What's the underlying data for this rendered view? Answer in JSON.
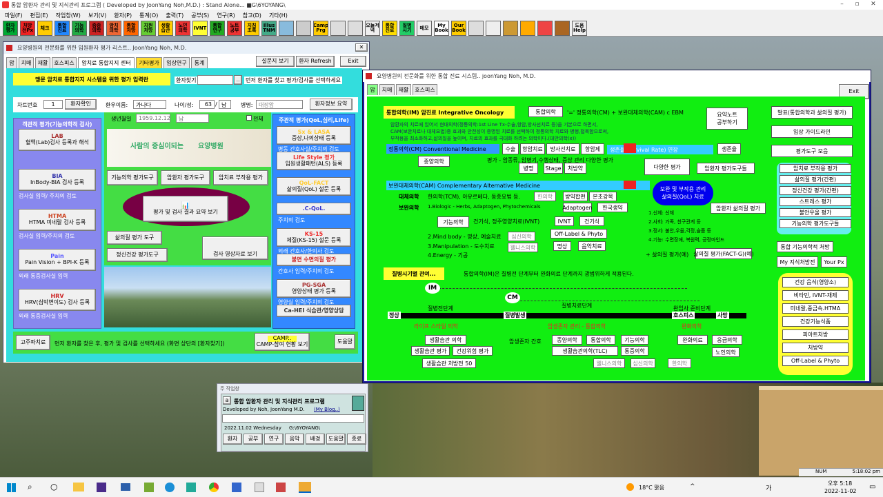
{
  "app_title": "통합 암환자 관리 및 지식관리 프로그램 ( Developed by JoonYang Noh,M.D.) : Stand Alone... ■G\\6YOYANG\\",
  "menu": [
    "파일(F)",
    "편집(E)",
    "작업창(W)",
    "보기(V)",
    "환자(P)",
    "통계(O)",
    "출력(T)",
    "공부(S)",
    "연구(R)",
    "참고(D)",
    "기타(H)"
  ],
  "toolbar": [
    "환자\n평가",
    "처방\n전Px",
    "체크\n",
    "통합\n진료",
    "기능\n의학",
    "중증\n의학",
    "암치\n의학",
    "통합\n처방",
    "지원\n처방",
    "생활\n습관",
    "노인\n의학",
    "IVNT",
    "통합\n연구",
    "노트\n공부",
    "지침\n초록",
    "Illus\nTNM",
    "",
    "",
    "Camp\nPrg",
    "",
    "",
    "오늘저\n녁",
    "통합\n진료",
    "질병\n시기",
    "메모",
    "My\nBook",
    "Our\nBook",
    "",
    "",
    "",
    "",
    "",
    "",
    "도움\nHelp"
  ],
  "w1": {
    "title": "요양병원의 전문화를 위한 입원환자 평가 리스트.. JoonYang Noh, M.D.",
    "tabs": [
      "암",
      "치매",
      "재활",
      "호스피스",
      "암치료 통합지지 센터",
      "기타평가",
      "임상연구",
      "통계"
    ],
    "btn_survey": "설문지 보기",
    "btn_refresh": "환자 Refresh",
    "btn_exit": "Exit",
    "banner": "맹문 암치료 통합지지 시스템을 위한 평가 입력란",
    "find_label": "환자찾기",
    "find_btn": "..",
    "find_hint": "먼저 환자를 찾고 평가/검사를 선택하세요",
    "chart_label": "차트번호",
    "chart_no": "1",
    "confirm_btn": "환자확인",
    "name_label": "환우이름:",
    "name": "가나다",
    "age_label": "나이/성:",
    "age": "63",
    "sex": "남",
    "dx_label": "병명:",
    "dx": "대장암",
    "summary_btn": "환자정보 요약",
    "left_header": "객관적 평가(기능의학적 검사)",
    "left_items": [
      {
        "btn": "LAB",
        "sub": "혈액(Lab)검사 등록과 해석",
        "cap": ""
      },
      {
        "btn": "BIA",
        "sub": "InBody-BIA 검사 등록",
        "cap": "검사실 입력/ 주치의 검토"
      },
      {
        "btn": "HTMA",
        "sub": "HTMA 미네랄 검사 등록",
        "cap": "검사실 입력/주치의 검토"
      },
      {
        "btn": "Pain",
        "sub": "Pain Vision + BPI-K 등록",
        "cap": "외래 통증검사실 입력"
      },
      {
        "btn": "HRV",
        "sub": "HRV(심박변이도) 검사 등록",
        "cap": "외래 통증검사실 입력"
      }
    ],
    "birth_label": "생년월일",
    "birth": "1959.12.12",
    "sex2": "남",
    "all_label": "전체",
    "hospital_slogan": "사람의 중심이되는",
    "hospital_name": "요양병원",
    "mid_btns": [
      "기능의학 평가도구",
      "암환자 평가도구",
      "암치료 부작용 평가"
    ],
    "summary_view": "평가 및 검사 결과 요약 보기",
    "qol_tool": "삶의질 평가 도구",
    "img_view": "검사 영상자료 보기",
    "mental_tool": "정신건강 평가도구",
    "right_header": "주관적 평가(QoL,심리,Life)",
    "right_items": [
      {
        "btn": "Sx & LASA",
        "sub": "증상,나의상태 등록",
        "cap": "병동 간호사실/주치의 검토"
      },
      {
        "btn": "Life Style 평가",
        "sub": "입원생활패턴(ALS) 등록",
        "cap": ""
      },
      {
        "btn": "QoL-FACT",
        "sub": "삶의질(QoL) 설문 등록",
        "cap": ""
      },
      {
        "btn": ".C-QoL.",
        "sub": "",
        "cap": "주치의 검토"
      },
      {
        "btn": "KS-15",
        "sub": "체질(KS-15) 설문 등록",
        "cap": "외래 간호사/한의사 검토"
      },
      {
        "btn": "불면 수면의질 평가",
        "sub": "",
        "cap": "간호사 입력/주치의 검토"
      },
      {
        "btn": "PG-SGA",
        "sub": "영양상태 평가 등록",
        "cap": "영양실 입력/주치의 검토"
      },
      {
        "btn": "Ca-HEI 식습관/영양상담",
        "sub": "",
        "cap": ""
      }
    ],
    "bottom_btn": "고주파치료",
    "bottom_hint": "먼저 환자를 찾은 후, 평가 및 검사를 선택하세요 (화면 상단의 [환자찾기])",
    "camp_btn": "CAMP..",
    "camp_sub": "CAMP-참여 현황 보기",
    "help_btn": "도움말"
  },
  "w2": {
    "title": "요양병원의 전문화를 위한 통합 진료 시스템.. joonYang Noh, M.D.",
    "tabs": [
      "암",
      "치매",
      "재활",
      "호스피스"
    ],
    "exit": "Exit",
    "io_title": "통합의학(IM) 암진료 Integrative Oncology",
    "io_btn": "통합의학",
    "io_formula": "'=' 정통의학(CM) + 보완대체의학(CAM) c EBM",
    "io_desc": [
      "암환자의 치료에 있어서 현대의학(정통의학:1st Line Tx-수술,항암,방사선치료 등)을 기본으로 하면서,",
      "CAM(보완치료나 대체요법)중 효과와 안전성이 증명된 치료를 선택하여 정통의학 치료와 병행,접목함으로써,",
      "부작용을 최소화하고,삶의질을 높이며, 치료의 효과를 극대화 하려는 의학이다.(대안의학(x))"
    ],
    "note_btn": "요약노트\n공부하기",
    "right_btns": [
      "발표(통합의학과 삶의질 평가)",
      "임상 가이드라인",
      "평가도구 모음"
    ],
    "cm_title": "정통의학(CM) Conventional Medicine",
    "cm_btns": [
      "수술",
      "항암치료",
      "방사선치료",
      "항암제"
    ],
    "survival": "생존율(Survival Rate) 연장",
    "survival_btn": "생존율",
    "cm_sub": "평가 - 암종류, 암병기,수행상태, 증상 관리 다양한 평가",
    "cm_row": [
      "병명",
      "Stage",
      "처방약"
    ],
    "tumor_btn": "종양의학",
    "diverse_btn": "다양한 평가",
    "cancer_tools": "암환자 평가도구들",
    "cam_title": "보완대체의학(CAM) Complementary Alternative Medicine",
    "qol_oval": "보완 및 부작용 관리\n삶의질(QoL) 치료",
    "trad_label": "대체의학",
    "trad_text": "한의학(TCM), 아유르베다, 동종요법 등.",
    "trad_btns": [
      "한의학",
      "방약합편",
      "본초강목"
    ],
    "comp_label": "보완의학",
    "comp_text": "1.Biologic - Herbs, Adaptogen, Phytochemicals",
    "comp_btns": [
      "Adaptogen",
      "한국생약"
    ],
    "func_btn": "기능의학",
    "supp_text": "건기식, 정주영양치료(IVNT)",
    "ivnt_btn": "IVNT",
    "food_btn": "건기식",
    "mind_text": "2.Mind body - 명상, 예술치료",
    "psy_btn": "심신의학",
    "offlabel_btn": "Off-Label & Phyto",
    "manip_text": "3.Manipulation - 도수치료",
    "wellness_btn": "웰니스의학",
    "meditate_btn": "명상",
    "music_btn": "음악치료",
    "energy_text": "4.Energy - 기공",
    "qol_items": [
      "1.신체: 신체",
      "2.사회: 가족, 친구관계 등",
      "3.정서: 불안,우울,걱정,슬픔 등",
      "4.기능: 수면장애, 복원력, 긍정마인드"
    ],
    "qol_eval": "+ 삶의질 평가(예)",
    "qol_fact": "삶의질 평가(FACT-G)(예)",
    "qol_survey": "암환자 삶의질 평가",
    "side_btns": [
      "암치료 부작용 평가",
      "삶의질 평가(간편)",
      "정신건강 평가(간편)",
      "스트레스 평가",
      "불안우울 평가",
      "기능의학 평가도구들"
    ],
    "integ_btn": "통합 기능의학적 처방",
    "know_btn": "My 지식처방전",
    "your_btn": "Your Px",
    "life_title": "질병시기별 관여...",
    "life_desc": "통합의학(IM)은 질병전 단계부터 완화의료 단계까지 광범위하게 적용된다.",
    "im_label": "IM",
    "cm_label": "CM",
    "stage_pre": "질병전단계",
    "stage_tx": "질병치료단계",
    "stage_end": "완임사 준비단계",
    "labels": [
      "정상",
      "질병발생",
      "호스피스",
      "사망"
    ],
    "red_labels": [
      "라이프 스타일 의학",
      "암생존자 관리 - 통합의학",
      "완화의학"
    ],
    "bottom_btns": [
      "생활습관 의학",
      "생활습관 평가",
      "건강위험 평가",
      "생활습관 처방전 50",
      "종양의학",
      "통합의학",
      "기능의학",
      "생활습관의학(TLC)",
      "통증의학",
      "웰니스의학",
      "심신의학",
      "한의학",
      "완화의료",
      "응급의학",
      "노인의학"
    ],
    "survivor": "암생존자 간호",
    "yellow_btns": [
      "건강 음식(영양소)",
      "비타민, IVNT-재제",
      "미네랄,중금속.HTMA",
      "건강기능식품",
      "피아트처방",
      "처방약",
      "Off-Label & Phyto"
    ]
  },
  "w3": {
    "title": "주 작업창",
    "app": "통합 암환자 관리 및 지식관리 프로그램",
    "dev": "Developed by Noh, JoonYang M.D.",
    "blog": "(My Blog..)",
    "date": "2022.11.02 Wednesday",
    "path": "G:\\6YOYANG\\",
    "btns": [
      "환자",
      "공부",
      "연구",
      "음악",
      "배경",
      "도움말",
      "종료"
    ]
  },
  "status": {
    "num": "NUM",
    "time": "5:18:02 pm"
  },
  "taskbar": {
    "weather": "18°C 맑음",
    "ime": "가",
    "clock": "오후 5:18",
    "date": "2022-11-02"
  }
}
